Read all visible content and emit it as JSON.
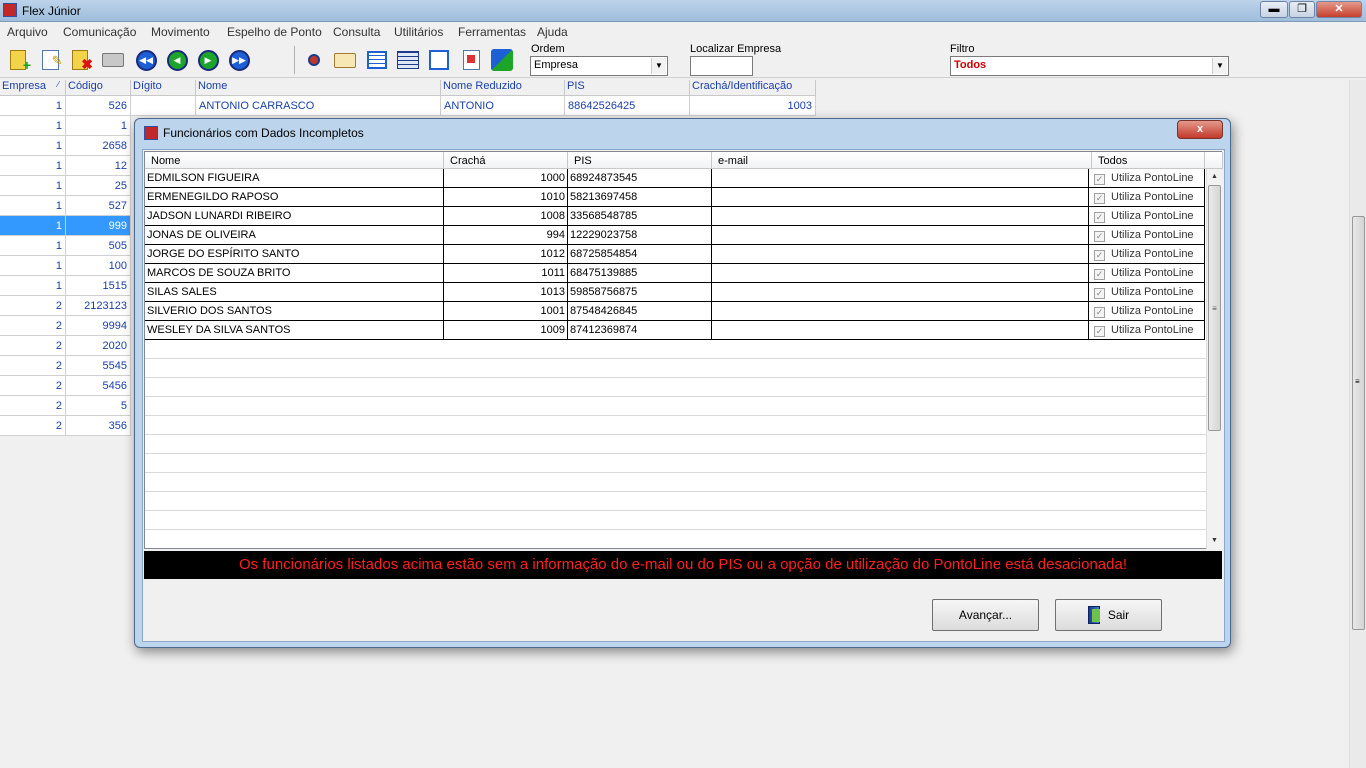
{
  "window": {
    "title": "Flex Júnior"
  },
  "menu": [
    "Arquivo",
    "Comunicação",
    "Movimento",
    "Espelho de Ponto",
    "Consulta",
    "Utilitários",
    "Ferramentas",
    "Ajuda"
  ],
  "toolbar": {
    "ordem_label": "Ordem",
    "ordem_value": "Empresa",
    "localizar_label": "Localizar Empresa",
    "localizar_value": "",
    "filtro_label": "Filtro",
    "filtro_value": "Todos"
  },
  "grid": {
    "headers": [
      "Empresa",
      "Código",
      "Dígito",
      "Nome",
      "Nome Reduzido",
      "PIS",
      "Crachá/Identificação"
    ],
    "first_row": {
      "empresa": "1",
      "codigo": "526",
      "digito": "",
      "nome": "ANTONIO CARRASCO",
      "nome_reduzido": "ANTONIO",
      "pis": "88642526425",
      "cracha": "1003"
    },
    "rows": [
      {
        "empresa": "1",
        "codigo": "1"
      },
      {
        "empresa": "1",
        "codigo": "2658"
      },
      {
        "empresa": "1",
        "codigo": "12"
      },
      {
        "empresa": "1",
        "codigo": "25"
      },
      {
        "empresa": "1",
        "codigo": "527"
      },
      {
        "empresa": "1",
        "codigo": "999",
        "selected": true
      },
      {
        "empresa": "1",
        "codigo": "505"
      },
      {
        "empresa": "1",
        "codigo": "100"
      },
      {
        "empresa": "1",
        "codigo": "1515"
      },
      {
        "empresa": "2",
        "codigo": "2123123"
      },
      {
        "empresa": "2",
        "codigo": "9994"
      },
      {
        "empresa": "2",
        "codigo": "2020"
      },
      {
        "empresa": "2",
        "codigo": "5545"
      },
      {
        "empresa": "2",
        "codigo": "5456"
      },
      {
        "empresa": "2",
        "codigo": "5"
      },
      {
        "empresa": "2",
        "codigo": "356"
      }
    ]
  },
  "dialog": {
    "title": "Funcionários com Dados Incompletos",
    "close_label": "x",
    "columns": [
      "Nome",
      "Crachá",
      "PIS",
      "e-mail",
      "Todos"
    ],
    "rows": [
      {
        "nome": "EDMILSON FIGUEIRA",
        "cracha": "1000",
        "pis": "68924873545",
        "email": "",
        "opt": "Utiliza PontoLine"
      },
      {
        "nome": "ERMENEGILDO RAPOSO",
        "cracha": "1010",
        "pis": "58213697458",
        "email": "",
        "opt": "Utiliza PontoLine"
      },
      {
        "nome": "JADSON LUNARDI RIBEIRO",
        "cracha": "1008",
        "pis": "33568548785",
        "email": "",
        "opt": "Utiliza PontoLine"
      },
      {
        "nome": "JONAS DE OLIVEIRA",
        "cracha": "994",
        "pis": "12229023758",
        "email": "",
        "opt": "Utiliza PontoLine"
      },
      {
        "nome": "JORGE DO ESPÍRITO SANTO",
        "cracha": "1012",
        "pis": "68725854854",
        "email": "",
        "opt": "Utiliza PontoLine"
      },
      {
        "nome": "MARCOS DE SOUZA BRITO",
        "cracha": "1011",
        "pis": "68475139885",
        "email": "",
        "opt": "Utiliza PontoLine"
      },
      {
        "nome": "SILAS SALES",
        "cracha": "1013",
        "pis": "59858756875",
        "email": "",
        "opt": "Utiliza PontoLine"
      },
      {
        "nome": "SILVERIO DOS SANTOS",
        "cracha": "1001",
        "pis": "87548426845",
        "email": "",
        "opt": "Utiliza PontoLine"
      },
      {
        "nome": "WESLEY DA SILVA SANTOS",
        "cracha": "1009",
        "pis": "87412369874",
        "email": "",
        "opt": "Utiliza PontoLine"
      }
    ],
    "warning": "Os funcionários listados acima estão sem a informação do e-mail ou do PIS ou a opção de utilização  do PontoLine está desacionada!",
    "avancar_label": "Avançar...",
    "sair_label": "Sair"
  },
  "colors": {
    "accent": "#1a3fa8",
    "selection": "#3399ff",
    "warning_text": "#ff1f1f",
    "warning_bg": "#000000",
    "filtro_text": "#cc0000"
  }
}
